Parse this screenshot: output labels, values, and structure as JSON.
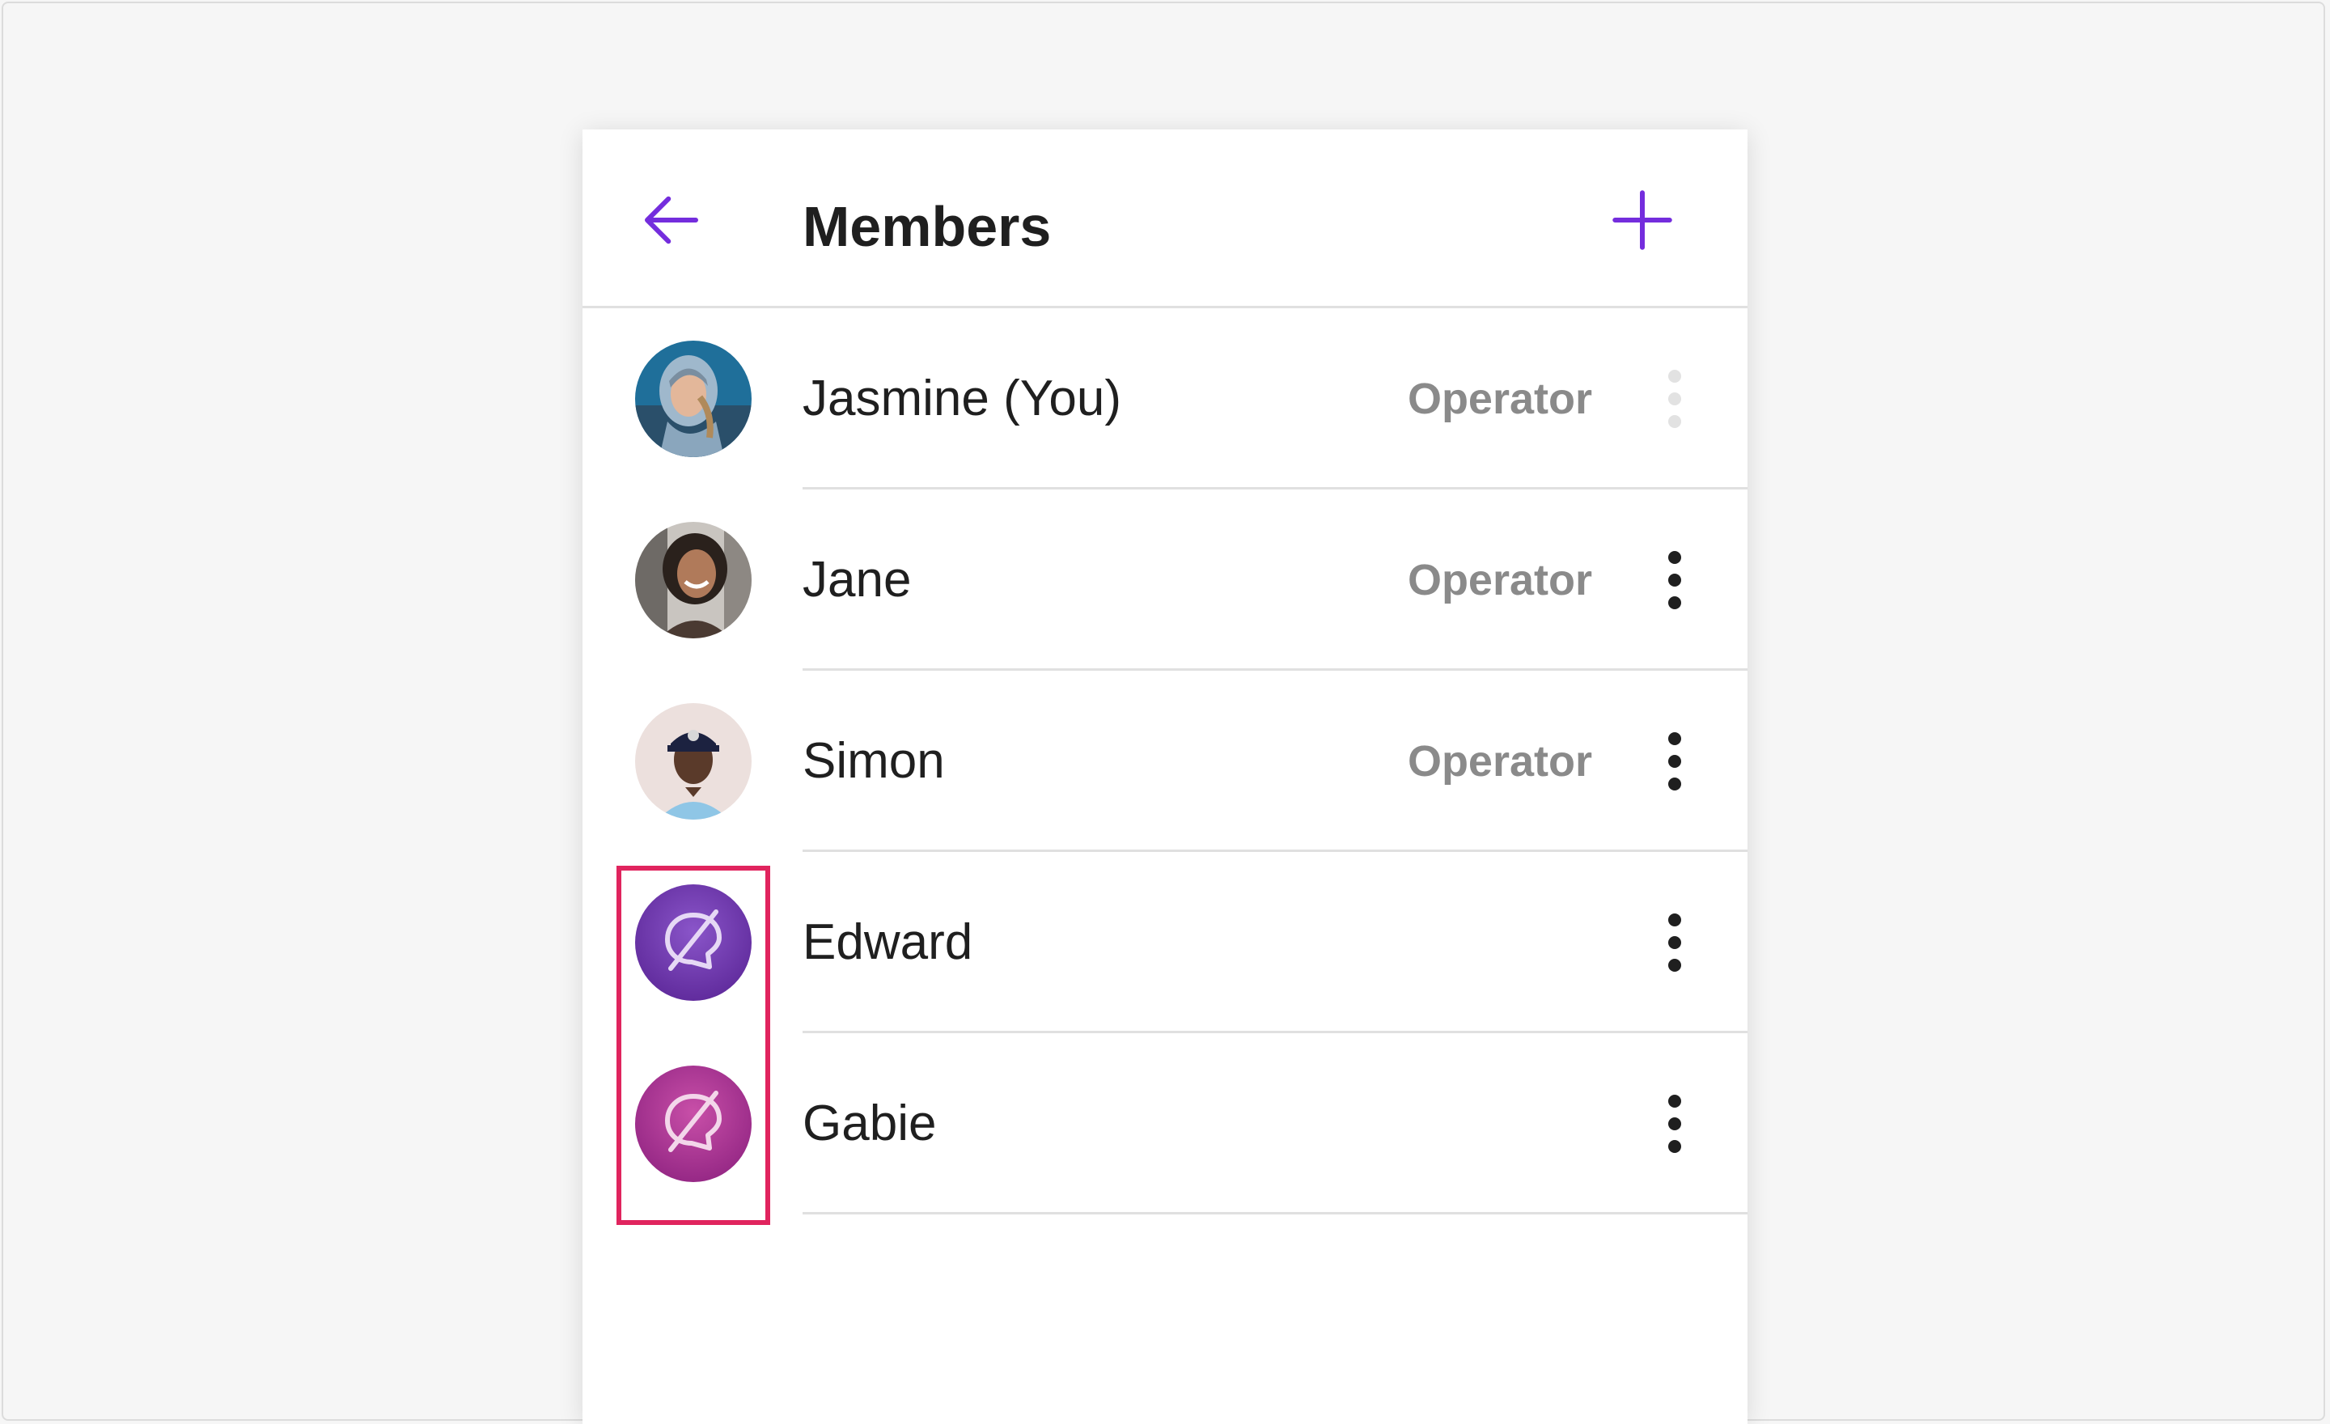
{
  "header": {
    "title": "Members",
    "back_icon": "arrow-left-icon",
    "add_icon": "plus-icon",
    "accent_color": "#742ddd"
  },
  "members": [
    {
      "name": "Jasmine (You)",
      "role": "Operator",
      "avatar": "photo",
      "menu_enabled": false
    },
    {
      "name": "Jane",
      "role": "Operator",
      "avatar": "photo",
      "menu_enabled": true
    },
    {
      "name": "Simon",
      "role": "Operator",
      "avatar": "photo",
      "menu_enabled": true
    },
    {
      "name": "Edward",
      "role": "",
      "avatar": "default-placeholder",
      "menu_enabled": true
    },
    {
      "name": "Gabie",
      "role": "",
      "avatar": "default-placeholder",
      "menu_enabled": true
    }
  ],
  "colors": {
    "highlight": "#e0245e",
    "placeholder_edward": "#6b2ea8",
    "placeholder_gabie": "#b0298f"
  }
}
